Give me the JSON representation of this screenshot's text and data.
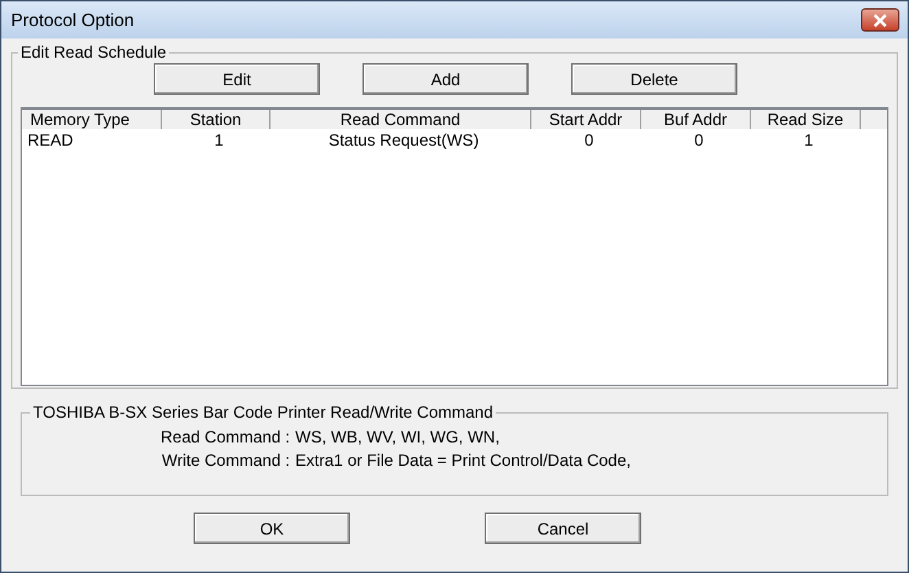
{
  "window": {
    "title": "Protocol Option"
  },
  "schedule": {
    "title": "Edit Read Schedule",
    "buttons": [
      "Edit",
      "Add",
      "Delete"
    ],
    "table": {
      "columns": [
        "Memory Type",
        "Station",
        "Read Command",
        "Start Addr",
        "Buf Addr",
        "Read Size"
      ],
      "rows": [
        [
          "READ",
          "1",
          "Status Request(WS)",
          "0",
          "0",
          "1"
        ]
      ]
    }
  },
  "info": {
    "title": "TOSHIBA B-SX Series Bar Code Printer Read/Write Command",
    "lines": [
      {
        "label": "Read Command :",
        "value": "WS, WB, WV, WI, WG, WN,"
      },
      {
        "label": "Write Command :",
        "value": "Extra1 or File Data = Print Control/Data Code,"
      }
    ]
  },
  "buttons": [
    "OK",
    "Cancel"
  ]
}
